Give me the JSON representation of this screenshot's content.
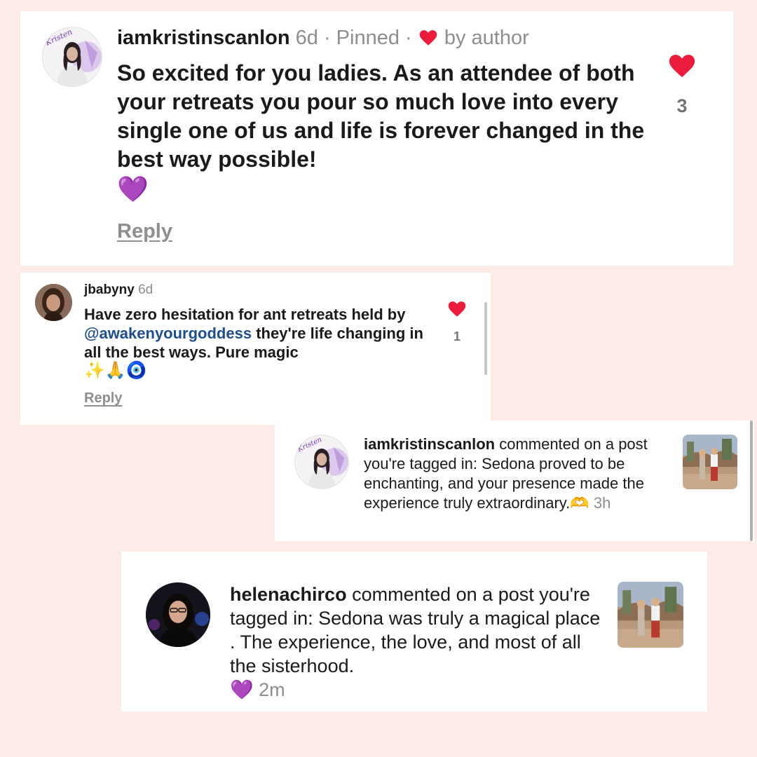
{
  "comment1": {
    "username": "iamkristinscanlon",
    "meta": "6d · Pinned ·",
    "liked_by": "by author",
    "text": "So excited for you ladies. As an attendee of both your retreats you pour so much love into every single one of us and life is forever changed in the best way possible!",
    "emoji": "💜",
    "reply_label": "Reply",
    "like_count": "3",
    "avatar_script": "Kristen"
  },
  "comment2": {
    "username": "jbabyny",
    "time": "6d",
    "text_before": "Have zero hesitation for ant retreats held by",
    "mention": "@awakenyourgoddess",
    "text_after": "they're life changing in all the best ways. Pure magic",
    "emoji": "✨🙏🧿",
    "reply_label": "Reply",
    "like_count": "1"
  },
  "notification1": {
    "username": "iamkristinscanlon",
    "text": "commented on a post you're tagged in: Sedona proved to be enchanting, and your presence made the experience truly extraordinary.",
    "emoji": "🫶",
    "time": "3h",
    "avatar_script": "Kristen"
  },
  "notification2": {
    "username": "helenachirco",
    "text": "commented on a post you're tagged in: Sedona was truly a magical place . The experience, the love, and most of all the sisterhood.",
    "emoji": "💜",
    "time": "2m"
  },
  "colors": {
    "background": "#fcebe6",
    "heart": "#ed1c3b",
    "mention": "#1f4e8c",
    "purple_heart": "#9b45e4",
    "meta": "#8e8e8e"
  }
}
